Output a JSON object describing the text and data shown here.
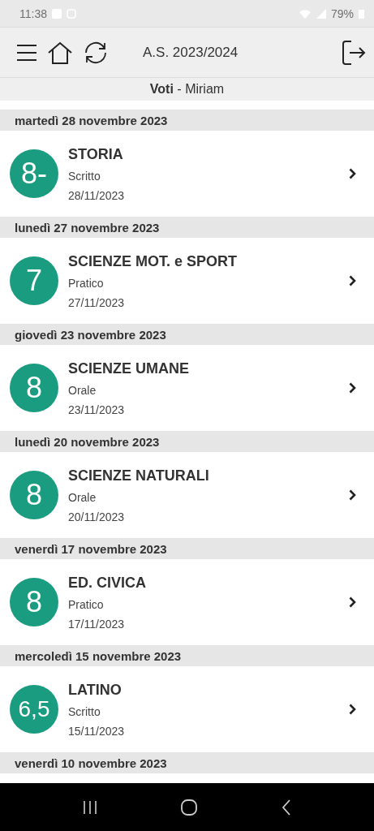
{
  "status_bar": {
    "time": "11:38",
    "battery": "79%"
  },
  "header": {
    "school_year": "A.S. 2023/2024"
  },
  "subtitle": {
    "section": "Voti",
    "separator": "-",
    "student": "Miriam"
  },
  "days": [
    {
      "date": "martedì 28 novembre 2023",
      "grades": [
        {
          "value": "8-",
          "subject": "STORIA",
          "type": "Scritto",
          "date": "28/11/2023"
        }
      ]
    },
    {
      "date": "lunedì 27 novembre 2023",
      "grades": [
        {
          "value": "7",
          "subject": "SCIENZE MOT. e SPORT",
          "type": "Pratico",
          "date": "27/11/2023"
        }
      ]
    },
    {
      "date": "giovedì 23 novembre 2023",
      "grades": [
        {
          "value": "8",
          "subject": "SCIENZE UMANE",
          "type": "Orale",
          "date": "23/11/2023"
        }
      ]
    },
    {
      "date": "lunedì 20 novembre 2023",
      "grades": [
        {
          "value": "8",
          "subject": "SCIENZE NATURALI",
          "type": "Orale",
          "date": "20/11/2023"
        }
      ]
    },
    {
      "date": "venerdì 17 novembre 2023",
      "grades": [
        {
          "value": "8",
          "subject": "ED. CIVICA",
          "type": "Pratico",
          "date": "17/11/2023"
        }
      ]
    },
    {
      "date": "mercoledì 15 novembre 2023",
      "grades": [
        {
          "value": "6,5",
          "subject": "LATINO",
          "type": "Scritto",
          "date": "15/11/2023"
        }
      ]
    },
    {
      "date": "venerdì 10 novembre 2023"
    }
  ]
}
